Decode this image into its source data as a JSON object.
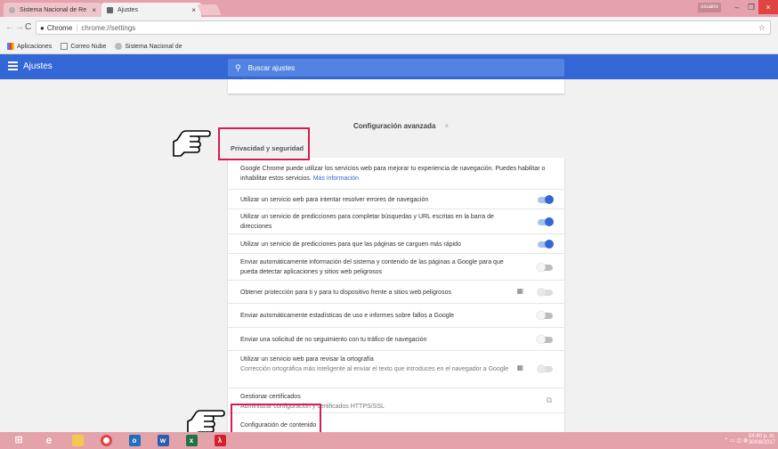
{
  "browser": {
    "tabs": [
      {
        "title": "Sistema Nacional de Re",
        "active": false
      },
      {
        "title": "Ajustes",
        "active": true
      }
    ],
    "omnibox_label": "Chrome",
    "url": "chrome://settings",
    "bookmarks": [
      {
        "label": "Aplicaciones",
        "icon": "apps-grid-icon"
      },
      {
        "label": "Correo Nube",
        "icon": "mail-icon"
      },
      {
        "label": "Sistema Nacional de",
        "icon": "globe-icon"
      }
    ],
    "user_badge": "usuario"
  },
  "header": {
    "title": "Ajustes",
    "search_placeholder": "Buscar ajustes"
  },
  "content": {
    "advanced_label": "Configuración avanzada",
    "section_title": "Privacidad y seguridad",
    "intro_text": "Google Chrome puede utilizar los servicios web para mejorar tu experiencia de navegación. Puedes habilitar o inhabilitar estos servicios.",
    "intro_link": "Más información",
    "rows": [
      {
        "label": "Utilizar un servicio web para intentar resolver errores de navegación",
        "state": "on"
      },
      {
        "label": "Utilizar un servicio de predicciones para completar búsquedas y URL escritas en la barra de direcciones",
        "state": "on"
      },
      {
        "label": "Utilizar un servicio de predicciones para que las páginas se carguen más rápido",
        "state": "on"
      },
      {
        "label": "Enviar automáticamente información del sistema y contenido de las páginas a Google para que pueda detectar aplicaciones y sitios web peligrosos",
        "state": "off"
      },
      {
        "label": "Obtener protección para ti y para tu dispositivo frente a sitios web peligrosos",
        "state": "disabled"
      },
      {
        "label": "Enviar automáticamente estadísticas de uso e informes sobre fallos a Google",
        "state": "off"
      },
      {
        "label": "Enviar una solicitud de no seguimiento con tu tráfico de navegación",
        "state": "off"
      },
      {
        "label": "Utilizar un servicio web para revisar la ortografía",
        "sub": "Corrección ortográfica más inteligente al enviar el texto que introduces en el navegador a Google",
        "state": "disabled"
      }
    ],
    "certs_label": "Gestionar certificados",
    "certs_sub": "Administrar configuración y certificados HTTPS/SSL",
    "content_settings_label": "Configuración de contenido"
  },
  "taskbar": {
    "clock_time": "04:40 p. m.",
    "clock_date": "30/08/2017"
  },
  "colors": {
    "accent": "#3367d6",
    "highlight": "#d81b50",
    "titlebar": "#e6a2ac"
  }
}
